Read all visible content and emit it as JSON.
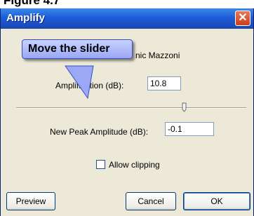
{
  "caption": "Figure 4.7",
  "dialog": {
    "title": "Amplify",
    "close_glyph": "✕",
    "author": "nic Mazzoni",
    "amplification_label": "Amplification (dB):",
    "amplification_value": "10.8",
    "new_peak_label": "New Peak Amplitude (dB):",
    "new_peak_value": "-0.1",
    "allow_clipping_label": "Allow clipping",
    "allow_clipping_checked": false,
    "buttons": {
      "preview": "Preview",
      "cancel": "Cancel",
      "ok": "OK"
    }
  },
  "callout": {
    "text": "Move the slider"
  },
  "colors": {
    "titlebar": "#1d5bd8",
    "dialog_bg": "#ece9d8",
    "callout_bg": "#a9b5f8"
  },
  "icons": {
    "close": "close-icon",
    "slider_thumb": "slider-thumb-icon",
    "checkbox": "checkbox-icon"
  }
}
